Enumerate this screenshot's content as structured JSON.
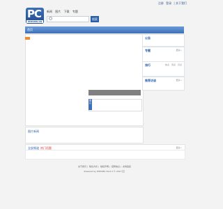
{
  "top_links": [
    "注册",
    "登录",
    "| 关于我们"
  ],
  "logo": {
    "text": "PC",
    "tagline": "PHPCMS.CN"
  },
  "nav": [
    "新闻",
    "图片",
    "下载",
    "专题"
  ],
  "search": {
    "button": "搜索"
  },
  "navbar": {
    "home": "首页"
  },
  "caption_panel": {
    "tab": "图 片"
  },
  "category": {
    "title": "图片新闻"
  },
  "sidebar": {
    "announce": {
      "title": "公告",
      "more": ""
    },
    "special": {
      "title": "专题",
      "more": "更多>"
    },
    "ranking": {
      "title": "排行",
      "tabs": [
        "热点",
        "周点",
        "月点"
      ]
    },
    "interview": {
      "title": "推荐访谈",
      "more": "更多>"
    }
  },
  "hot": {
    "label": "全部频道",
    "highlight": "热门话题",
    "more": "更多>"
  },
  "footer": {
    "links": [
      "关于我们",
      "联系方式",
      "版权声明",
      "招聘信息",
      "友情链接"
    ],
    "powered": "Powered by PHPCMS V9.6.3 © 2017"
  }
}
